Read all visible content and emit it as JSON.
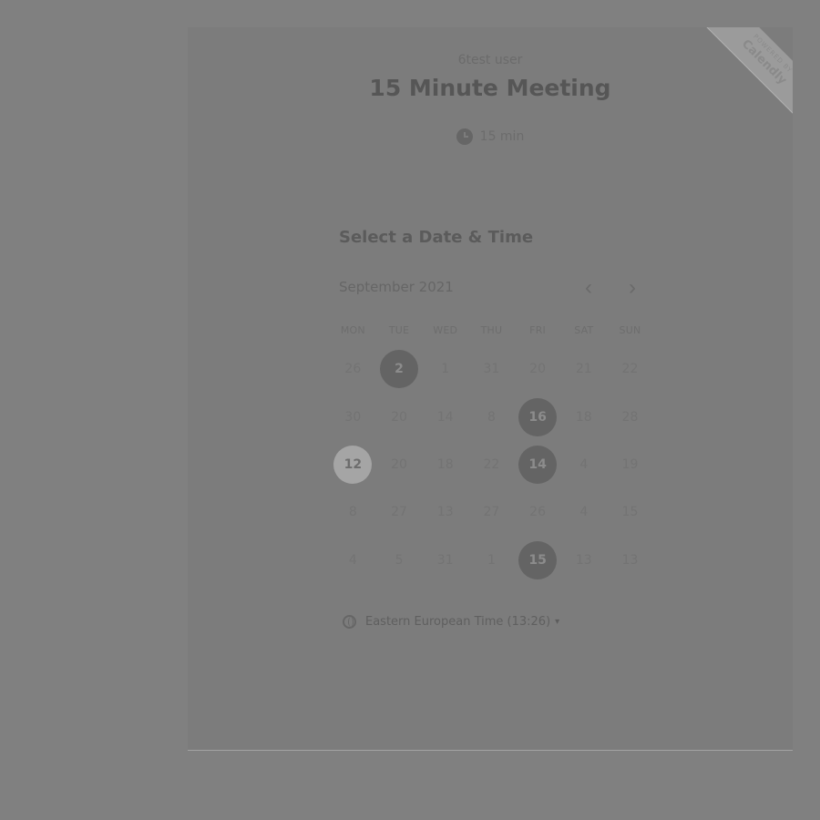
{
  "header": {
    "user_name": "6test user",
    "title": "15 Minute Meeting",
    "duration": "15 min"
  },
  "ribbon": {
    "small_text": "POWERED BY",
    "brand": "Calendly"
  },
  "calendar": {
    "section_title": "Select a Date & Time",
    "month": "September 2021",
    "prev_icon": "‹",
    "next_icon": "›",
    "weekdays": [
      "MON",
      "TUE",
      "WED",
      "THU",
      "FRI",
      "SAT",
      "SUN"
    ],
    "days": [
      {
        "label": "26",
        "state": "default"
      },
      {
        "label": "2",
        "state": "available"
      },
      {
        "label": "1",
        "state": "default"
      },
      {
        "label": "31",
        "state": "default"
      },
      {
        "label": "20",
        "state": "default"
      },
      {
        "label": "21",
        "state": "default"
      },
      {
        "label": "22",
        "state": "default"
      },
      {
        "label": "30",
        "state": "default"
      },
      {
        "label": "20",
        "state": "default"
      },
      {
        "label": "14",
        "state": "default"
      },
      {
        "label": "8",
        "state": "default"
      },
      {
        "label": "16",
        "state": "available"
      },
      {
        "label": "18",
        "state": "default"
      },
      {
        "label": "28",
        "state": "default"
      },
      {
        "label": "12",
        "state": "today"
      },
      {
        "label": "20",
        "state": "default"
      },
      {
        "label": "18",
        "state": "default"
      },
      {
        "label": "22",
        "state": "default"
      },
      {
        "label": "14",
        "state": "available"
      },
      {
        "label": "4",
        "state": "default"
      },
      {
        "label": "19",
        "state": "default"
      },
      {
        "label": "8",
        "state": "default"
      },
      {
        "label": "27",
        "state": "default"
      },
      {
        "label": "13",
        "state": "default"
      },
      {
        "label": "27",
        "state": "default"
      },
      {
        "label": "26",
        "state": "default"
      },
      {
        "label": "4",
        "state": "default"
      },
      {
        "label": "15",
        "state": "default"
      },
      {
        "label": "4",
        "state": "default"
      },
      {
        "label": "5",
        "state": "default"
      },
      {
        "label": "31",
        "state": "default"
      },
      {
        "label": "1",
        "state": "default"
      },
      {
        "label": "15",
        "state": "available"
      },
      {
        "label": "13",
        "state": "default"
      },
      {
        "label": "13",
        "state": "default"
      }
    ]
  },
  "timezone": {
    "label": "Eastern European Time (13:26)",
    "caret": "▾"
  },
  "colors": {
    "background": "#808080",
    "card": "#7c7c7c",
    "available_day": "#646464",
    "today_day": "#a5a5a5"
  },
  "icons": {
    "duration": "clock-icon",
    "timezone": "globe-icon",
    "prev": "chevron-left-icon",
    "next": "chevron-right-icon"
  }
}
